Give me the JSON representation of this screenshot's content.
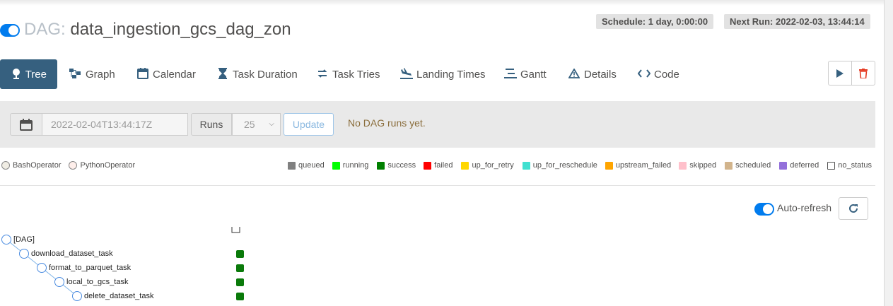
{
  "header": {
    "dag_prefix": "DAG:",
    "dag_id": "data_ingestion_gcs_dag_zon",
    "schedule": "Schedule: 1 day, 0:00:00",
    "next_run": "Next Run: 2022-02-03, 13:44:14"
  },
  "nav": [
    {
      "label": "Tree",
      "icon": "tree-icon",
      "active": true
    },
    {
      "label": "Graph",
      "icon": "graph-icon"
    },
    {
      "label": "Calendar",
      "icon": "calendar-icon"
    },
    {
      "label": "Task Duration",
      "icon": "hourglass-icon"
    },
    {
      "label": "Task Tries",
      "icon": "retry-icon"
    },
    {
      "label": "Landing Times",
      "icon": "plane-landing-icon"
    },
    {
      "label": "Gantt",
      "icon": "gantt-icon"
    },
    {
      "label": "Details",
      "icon": "warning-triangle-icon"
    },
    {
      "label": "Code",
      "icon": "code-icon"
    }
  ],
  "actions": {
    "trigger_icon": "play-icon",
    "delete_icon": "trash-icon"
  },
  "filters": {
    "date_value": "2022-02-04T13:44:17Z",
    "runs_label": "Runs",
    "runs_value": "25",
    "update_label": "Update",
    "message": "No DAG runs yet."
  },
  "operators": [
    {
      "label": "BashOperator",
      "color": "#f0ede4"
    },
    {
      "label": "PythonOperator",
      "color": "#ffefeb"
    }
  ],
  "states": [
    {
      "label": "queued",
      "color": "#808080"
    },
    {
      "label": "running",
      "color": "#00ff00"
    },
    {
      "label": "success",
      "color": "#008000"
    },
    {
      "label": "failed",
      "color": "#ff0000"
    },
    {
      "label": "up_for_retry",
      "color": "#ffd700"
    },
    {
      "label": "up_for_reschedule",
      "color": "#40e0d0"
    },
    {
      "label": "upstream_failed",
      "color": "#ffa500"
    },
    {
      "label": "skipped",
      "color": "#ffc0cb"
    },
    {
      "label": "scheduled",
      "color": "#d2b48c"
    },
    {
      "label": "deferred",
      "color": "#9370db"
    },
    {
      "label": "no_status",
      "color": "#ffffff"
    }
  ],
  "auto_refresh": {
    "label": "Auto-refresh",
    "enabled": true
  },
  "tree": [
    {
      "label": "[DAG]",
      "level": 0,
      "status": "none"
    },
    {
      "label": "download_dataset_task",
      "level": 1,
      "status": "success"
    },
    {
      "label": "format_to_parquet_task",
      "level": 2,
      "status": "success"
    },
    {
      "label": "local_to_gcs_task",
      "level": 3,
      "status": "success"
    },
    {
      "label": "delete_dataset_task",
      "level": 4,
      "status": "success"
    }
  ],
  "colors": {
    "accent": "#017cee",
    "nav_active": "#36607f",
    "success": "#0a7a0a"
  }
}
